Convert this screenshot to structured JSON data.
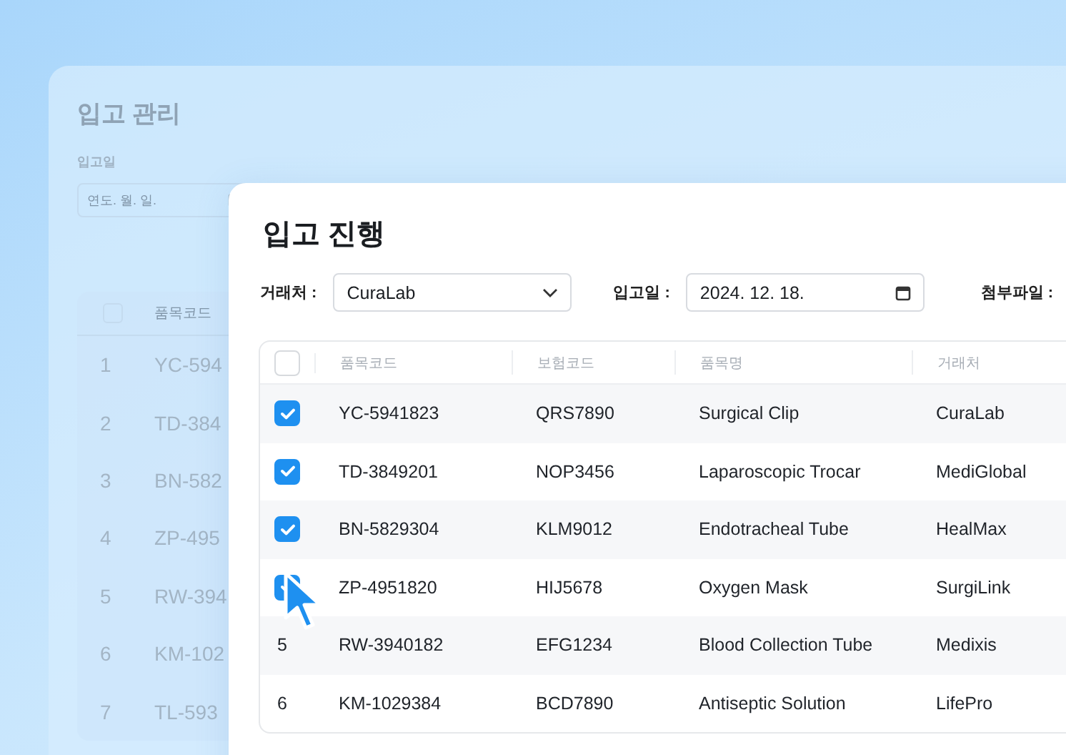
{
  "background_window": {
    "title": "입고 관리",
    "date_label": "입고일",
    "date_field": {
      "placeholder": "연도. 월. 일."
    },
    "table": {
      "header_checked": false,
      "column_1": "품목코드",
      "rows": [
        {
          "number": "1",
          "code": "YC-594"
        },
        {
          "number": "2",
          "code": "TD-384"
        },
        {
          "number": "3",
          "code": "BN-582"
        },
        {
          "number": "4",
          "code": "ZP-495"
        },
        {
          "number": "5",
          "code": "RW-394"
        },
        {
          "number": "6",
          "code": "KM-102"
        },
        {
          "number": "7",
          "code": "TL-593"
        }
      ]
    }
  },
  "modal": {
    "title": "입고 진행",
    "vendor": {
      "label": "거래처 :",
      "value": "CuraLab"
    },
    "date": {
      "label": "입고일 :",
      "value": "2024. 12. 18."
    },
    "attachment": {
      "label": "첨부파일 :"
    },
    "table": {
      "header_checked": false,
      "columns": [
        "품목코드",
        "보험코드",
        "품목명",
        "거래처"
      ],
      "rows": [
        {
          "checked": true,
          "code": "YC-5941823",
          "insurance_code": "QRS7890",
          "name": "Surgical Clip",
          "vendor": "CuraLab"
        },
        {
          "checked": true,
          "code": "TD-3849201",
          "insurance_code": "NOP3456",
          "name": "Laparoscopic Trocar",
          "vendor": "MediGlobal"
        },
        {
          "checked": true,
          "code": "BN-5829304",
          "insurance_code": "KLM9012",
          "name": "Endotracheal Tube",
          "vendor": "HealMax"
        },
        {
          "checked": true,
          "code": "ZP-4951820",
          "insurance_code": "HIJ5678",
          "name": "Oxygen Mask",
          "vendor": "SurgiLink"
        },
        {
          "checked": false,
          "number": "5",
          "code": "RW-3940182",
          "insurance_code": "EFG1234",
          "name": "Blood Collection Tube",
          "vendor": "Medixis"
        },
        {
          "checked": false,
          "number": "6",
          "code": "KM-1029384",
          "insurance_code": "BCD7890",
          "name": "Antiseptic Solution",
          "vendor": "LifePro"
        }
      ]
    }
  }
}
